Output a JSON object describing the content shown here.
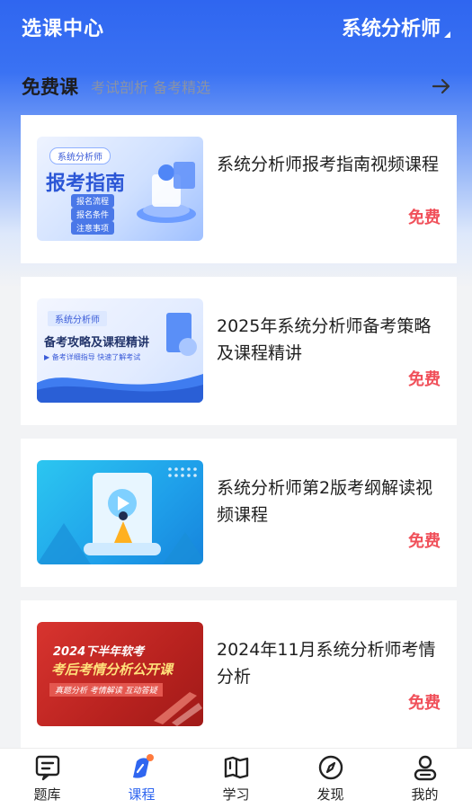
{
  "header": {
    "title": "选课中心",
    "exam": "系统分析师"
  },
  "section": {
    "title": "免费课",
    "subtitle": "考试剖析 备考精选"
  },
  "courses": [
    {
      "title": "系统分析师报考指南视频课程",
      "price": "免费",
      "thumb": {
        "tag": "系统分析师",
        "headline": "报考指南",
        "items": [
          "报名流程",
          "报名条件",
          "注意事项"
        ]
      }
    },
    {
      "title": "2025年系统分析师备考策略及课程精讲",
      "price": "免费",
      "thumb": {
        "tag": "系统分析师",
        "headline": "备考攻略及课程精讲",
        "note": "▶ 备考详细指导 快速了解考试"
      }
    },
    {
      "title": "系统分析师第2版考纲解读视频课程",
      "price": "免费",
      "thumb": {}
    },
    {
      "title": "2024年11月系统分析师考情分析",
      "price": "免费",
      "thumb": {
        "line1": "2024下半年软考",
        "line2": "考后考情分析公开课",
        "line3": "真题分析  考情解读  互动答疑"
      }
    }
  ],
  "tabs": [
    {
      "label": "题库",
      "icon": "question-bank-icon"
    },
    {
      "label": "课程",
      "icon": "course-icon"
    },
    {
      "label": "学习",
      "icon": "book-icon"
    },
    {
      "label": "发现",
      "icon": "compass-icon"
    },
    {
      "label": "我的",
      "icon": "profile-icon"
    }
  ],
  "colors": {
    "brand": "#2f66f0",
    "price": "#f0505a",
    "badge": "#ff7a3d"
  }
}
